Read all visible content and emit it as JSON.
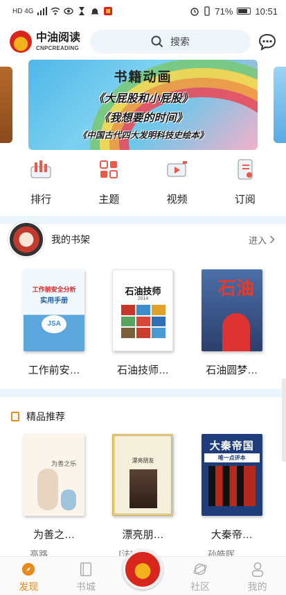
{
  "status_bar": {
    "left": "HD 4G",
    "battery": "71%",
    "time": "10:51"
  },
  "header": {
    "logo_cn": "中油阅读",
    "logo_en": "CNPCREADING",
    "search_placeholder": "搜索"
  },
  "banner": {
    "title": "书籍动画",
    "line1": "《大屁股和小屁股》",
    "line2": "《我想要的时间》",
    "line3": "《中国古代四大发明科技史绘本》"
  },
  "categories": [
    {
      "label": "排行",
      "icon": "ranking-icon"
    },
    {
      "label": "主题",
      "icon": "theme-grid-icon"
    },
    {
      "label": "视频",
      "icon": "video-icon"
    },
    {
      "label": "订阅",
      "icon": "subscribe-icon"
    }
  ],
  "bookshelf": {
    "title": "我的书架",
    "enter": "进入",
    "books": [
      {
        "title": "工作前安…",
        "cover_text": "工作前安全分析",
        "cover_sub": "实用手册",
        "cover_badge": "JSA"
      },
      {
        "title": "石油技师…",
        "cover_text": "石油技师",
        "cover_sub": "2014"
      },
      {
        "title": "石油圆梦…",
        "cover_text": "石油"
      }
    ]
  },
  "recommend": {
    "title": "精品推荐",
    "books": [
      {
        "title": "为善之…",
        "author": "高路",
        "cover_text": "为善之乐"
      },
      {
        "title": "漂亮朋…",
        "author": "[法]…",
        "cover_text": "漂亮朋友"
      },
      {
        "title": "大秦帝…",
        "author": "孙皓晖",
        "cover_text": "大秦帝国",
        "cover_sub": "唯一点评本"
      }
    ]
  },
  "bottom_nav": [
    {
      "label": "发现",
      "icon": "compass-icon",
      "active": true
    },
    {
      "label": "书城",
      "icon": "book-icon",
      "active": false
    },
    {
      "label": "社区",
      "icon": "planet-icon",
      "active": false
    },
    {
      "label": "我的",
      "icon": "person-icon",
      "active": false
    }
  ],
  "colors": {
    "accent": "#e88a1c",
    "brand_red": "#d8261c",
    "brand_yellow": "#f3b21b",
    "search_bg": "#eef6fb"
  }
}
